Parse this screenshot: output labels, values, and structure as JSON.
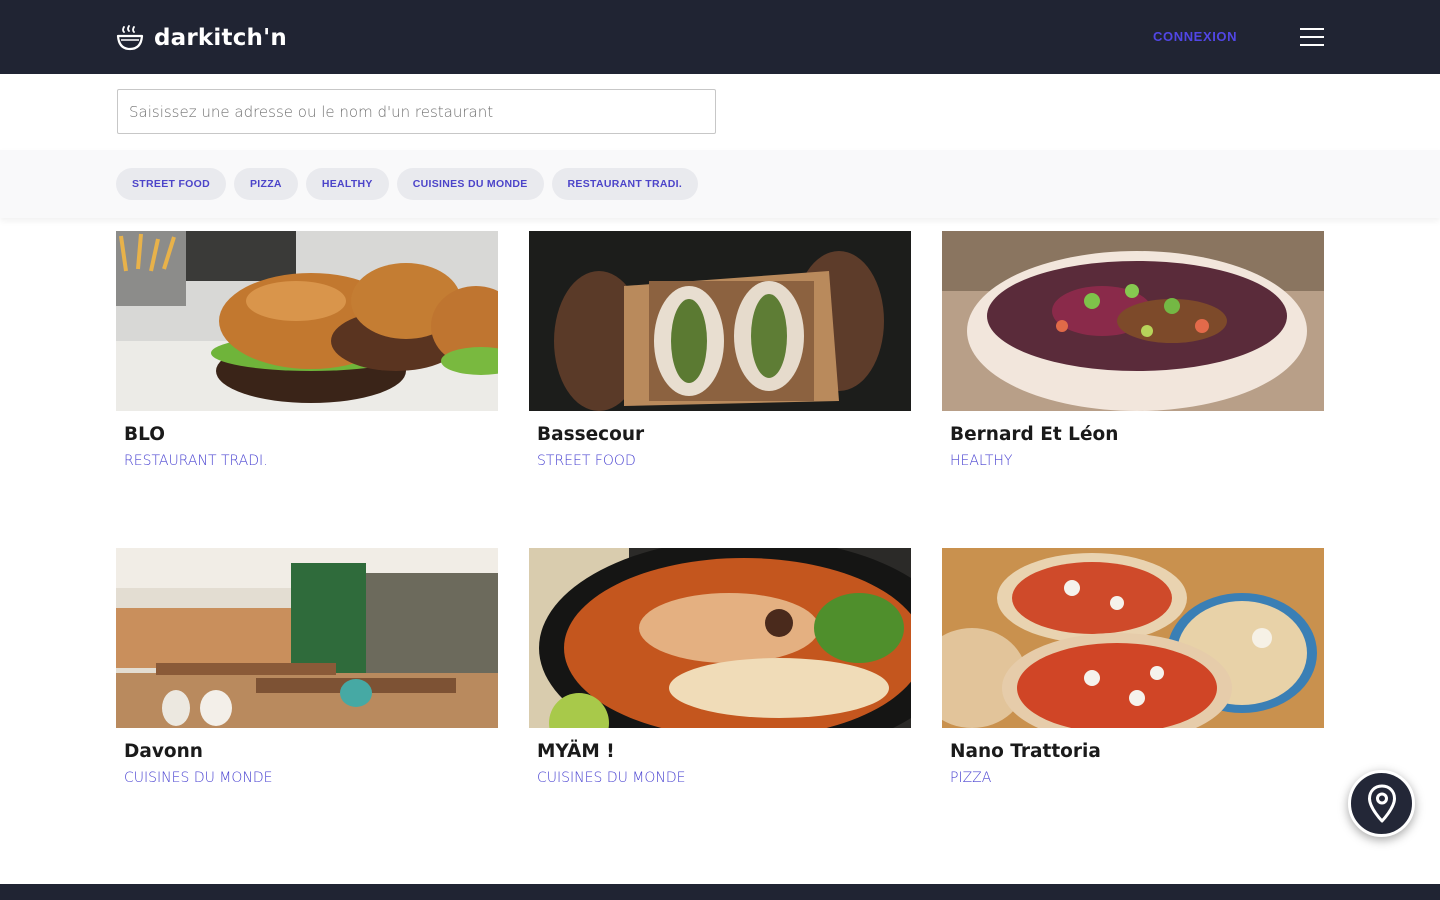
{
  "header": {
    "logo_text": "darkitch'n",
    "login_label": "CONNEXION",
    "menu_icon": "hamburger-icon"
  },
  "search": {
    "placeholder": "Saisissez une adresse ou le nom d'un restaurant"
  },
  "filters": [
    {
      "label": "STREET FOOD"
    },
    {
      "label": "PIZZA"
    },
    {
      "label": "HEALTHY"
    },
    {
      "label": "CUISINES DU MONDE"
    },
    {
      "label": "RESTAURANT TRADI."
    }
  ],
  "restaurants": [
    {
      "name": "BLO",
      "category": "RESTAURANT TRADI.",
      "photo": "burgers"
    },
    {
      "name": "Bassecour",
      "category": "STREET FOOD",
      "photo": "sandwich-box"
    },
    {
      "name": "Bernard Et Léon",
      "category": "HEALTHY",
      "photo": "salad-bowl"
    },
    {
      "name": "Davonn",
      "category": "CUISINES DU MONDE",
      "photo": "restaurant-interior"
    },
    {
      "name": "MYÄM !",
      "category": "CUISINES DU MONDE",
      "photo": "noodle-soup"
    },
    {
      "name": "Nano Trattoria",
      "category": "PIZZA",
      "photo": "pizzas"
    }
  ],
  "map_button_icon": "map-pin-icon",
  "colors": {
    "header_bg": "#202433",
    "accent": "#4a43d1",
    "chip_bg": "#e9eaee"
  }
}
